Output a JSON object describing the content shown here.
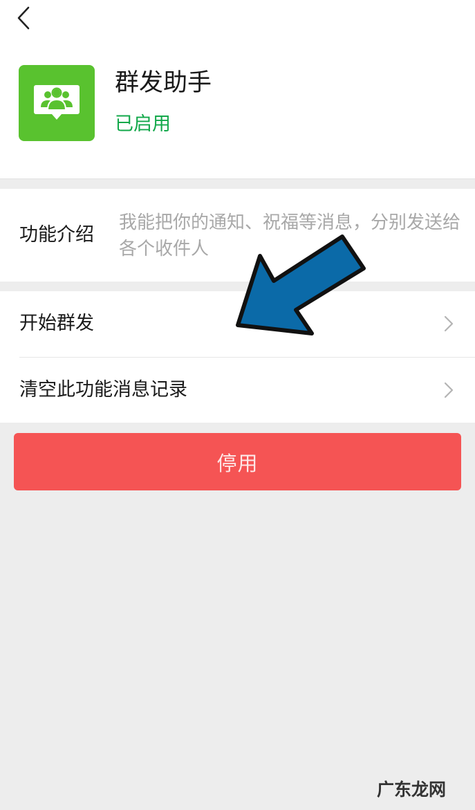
{
  "header": {
    "app_name": "群发助手",
    "status": "已启用"
  },
  "intro": {
    "label": "功能介绍",
    "text": "我能把你的通知、祝福等消息，分别发送给各个收件人"
  },
  "menu": {
    "items": [
      {
        "label": "开始群发"
      },
      {
        "label": "清空此功能消息记录"
      }
    ]
  },
  "disable_button": {
    "label": "停用"
  },
  "watermark": {
    "text": "广东龙网"
  },
  "colors": {
    "accent_green": "#12a84a",
    "app_icon_green": "#59c22f",
    "danger_red": "#f55454",
    "annotation_arrow": "#0b6aa8"
  },
  "icons": [
    "back-arrow-icon",
    "group-chat-icon",
    "chevron-right-icon"
  ]
}
